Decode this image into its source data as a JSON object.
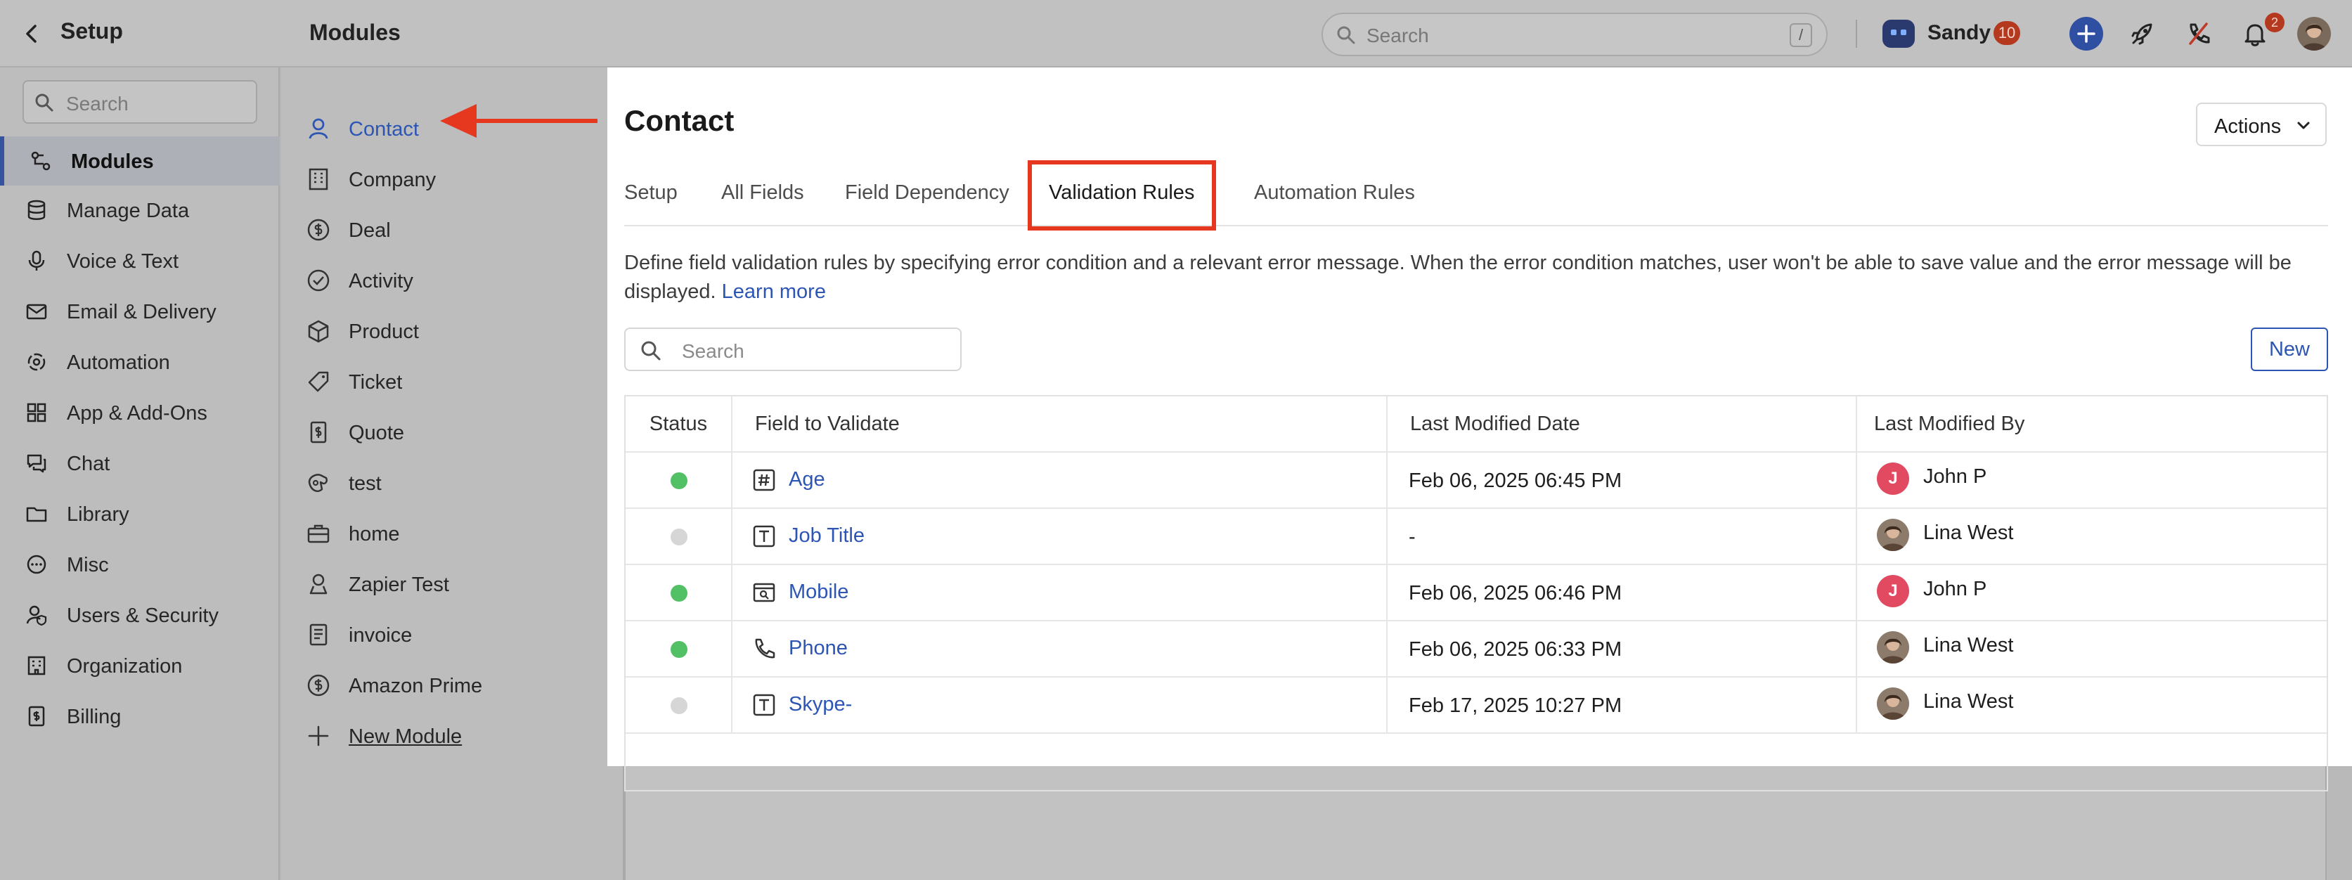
{
  "header": {
    "setup_title": "Setup",
    "modules_title": "Modules",
    "search_placeholder": "Search",
    "search_shortcut": "/",
    "user_name": "Sandy",
    "user_badge": "10",
    "notification_count": "2"
  },
  "sidebar": {
    "search_placeholder": "Search",
    "items": [
      {
        "label": "Modules",
        "icon": "modules-icon",
        "active": true
      },
      {
        "label": "Manage Data",
        "icon": "database-icon"
      },
      {
        "label": "Voice & Text",
        "icon": "microphone-icon"
      },
      {
        "label": "Email & Delivery",
        "icon": "envelope-icon"
      },
      {
        "label": "Automation",
        "icon": "automation-icon"
      },
      {
        "label": "App & Add-Ons",
        "icon": "apps-grid-icon"
      },
      {
        "label": "Chat",
        "icon": "chat-icon"
      },
      {
        "label": "Library",
        "icon": "folder-icon"
      },
      {
        "label": "Misc",
        "icon": "more-circle-icon"
      },
      {
        "label": "Users & Security",
        "icon": "users-security-icon"
      },
      {
        "label": "Organization",
        "icon": "organization-icon"
      },
      {
        "label": "Billing",
        "icon": "billing-icon"
      }
    ]
  },
  "modules": {
    "items": [
      {
        "label": "Contact",
        "icon": "person-icon",
        "active": true
      },
      {
        "label": "Company",
        "icon": "building-icon"
      },
      {
        "label": "Deal",
        "icon": "dollar-circle-icon"
      },
      {
        "label": "Activity",
        "icon": "check-circle-icon"
      },
      {
        "label": "Product",
        "icon": "box-icon"
      },
      {
        "label": "Ticket",
        "icon": "ticket-icon"
      },
      {
        "label": "Quote",
        "icon": "quote-icon"
      },
      {
        "label": "test",
        "icon": "custom-module-icon"
      },
      {
        "label": "home",
        "icon": "briefcase-icon"
      },
      {
        "label": "Zapier Test",
        "icon": "badge-icon"
      },
      {
        "label": "invoice",
        "icon": "invoice-icon"
      },
      {
        "label": "Amazon Prime",
        "icon": "dollar-circle-icon"
      }
    ],
    "new_module_label": "New Module"
  },
  "main": {
    "title": "Contact",
    "actions_label": "Actions",
    "tabs": [
      {
        "label": "Setup"
      },
      {
        "label": "All Fields"
      },
      {
        "label": "Field Dependency"
      },
      {
        "label": "Validation Rules",
        "active": true
      },
      {
        "label": "Automation Rules"
      }
    ],
    "description": "Define field validation rules by specifying error condition and a relevant error message. When the error condition matches, user won't be able to save value and the error message will be displayed.",
    "learn_more": "Learn more",
    "search_placeholder": "Search",
    "new_button": "New",
    "table": {
      "headers": [
        "Status",
        "Field to Validate",
        "Last Modified Date",
        "Last Modified By"
      ],
      "rows": [
        {
          "status": "active",
          "field": "Age",
          "field_icon": "number-field-icon",
          "date": "Feb 06, 2025 06:45 PM",
          "user": "John P",
          "avatar": "J"
        },
        {
          "status": "inactive",
          "field": "Job Title",
          "field_icon": "text-field-icon",
          "date": "-",
          "user": "Lina West",
          "avatar": "photo"
        },
        {
          "status": "active",
          "field": "Mobile",
          "field_icon": "mobile-field-icon",
          "date": "Feb 06, 2025 06:46 PM",
          "user": "John P",
          "avatar": "J"
        },
        {
          "status": "active",
          "field": "Phone",
          "field_icon": "phone-icon",
          "date": "Feb 06, 2025 06:33 PM",
          "user": "Lina West",
          "avatar": "photo"
        },
        {
          "status": "inactive",
          "field": "Skype-",
          "field_icon": "text-field-icon",
          "date": "Feb 17, 2025 10:27 PM",
          "user": "Lina West",
          "avatar": "photo"
        }
      ]
    }
  },
  "colors": {
    "accent": "#2c55b4",
    "status_active": "#52c065",
    "status_inactive": "#d6d6d6",
    "highlight": "#e5381f"
  }
}
